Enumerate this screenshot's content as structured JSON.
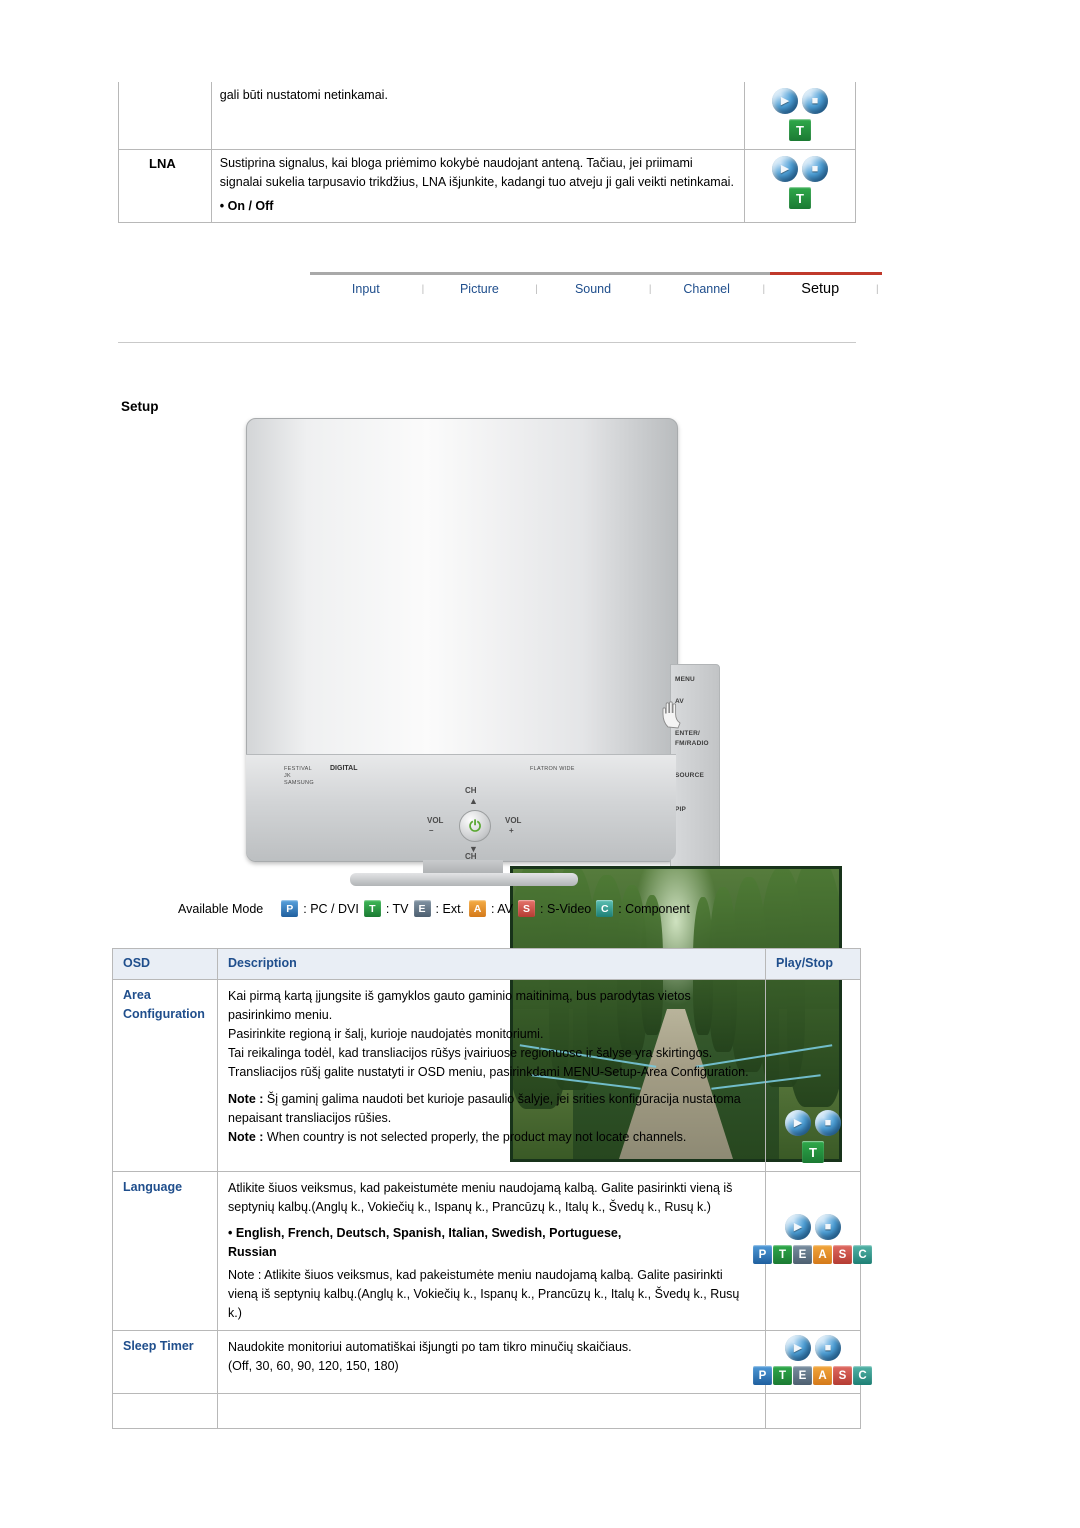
{
  "top_section": {
    "intro_line": "gali būti nustatomi netinkamai.",
    "rows": [
      {
        "label": "LNA",
        "text": "Sustiprina signalus, kai bloga priėmimo kokybė naudojant anteną. Tačiau, jei priimami signalai sukelia tarpusavio trikdžius, LNA išjunkite, kadangi tuo atveju ji gali veikti netinkamai.",
        "bullet": "• On / Off"
      }
    ]
  },
  "nav": {
    "items": [
      {
        "label": "Input",
        "active": false
      },
      {
        "label": "Picture",
        "active": false
      },
      {
        "label": "Sound",
        "active": false
      },
      {
        "label": "Channel",
        "active": false
      },
      {
        "label": "Setup",
        "active": true
      }
    ],
    "separator": "|"
  },
  "section": {
    "heading": "Setup"
  },
  "tv": {
    "logo_left_line1": "FESTIVAL",
    "logo_left_line2": "JK",
    "logo_left_line3": "SAMSUNG",
    "logo_dd": "DIGITAL",
    "logo_right": "FLATRON WIDE",
    "controls": {
      "ch_up": "CH",
      "ch_down": "CH",
      "vol_left": "VOL",
      "vol_right": "VOL",
      "vol_minus": "–",
      "vol_plus": "+",
      "power_icon": "power-icon"
    },
    "side_buttons": [
      "MENU",
      "AV",
      "ENTER/",
      "FM/RADIO",
      "SOURCE",
      "PIP"
    ]
  },
  "available_mode": {
    "label": "Available Mode",
    "items": [
      {
        "chip": "P",
        "text": ": PC / DVI",
        "color": "#2f78bd"
      },
      {
        "chip": "T",
        "text": ": TV",
        "color": "#2f9a44"
      },
      {
        "chip": "E",
        "text": ": Ext.",
        "color": "#6b7d8c"
      },
      {
        "chip": "A",
        "text": ": AV",
        "color": "#ee9b2a"
      },
      {
        "chip": "S",
        "text": ": S-Video",
        "color": "#d7544b"
      },
      {
        "chip": "C",
        "text": ": Component",
        "color": "#3aa79b"
      }
    ]
  },
  "osd_table": {
    "headers": [
      "OSD",
      "Description",
      "Play/Stop"
    ],
    "rows": [
      {
        "name_line1": "Area",
        "name_line2": "Configuration",
        "paragraphs": [
          "Kai pirmą kartą įjungsite iš gamyklos gauto gaminio maitinimą, bus parodytas vietos pasirinkimo meniu.",
          "Pasirinkite regioną ir šalį, kurioje naudojatės monitoriumi.",
          "Tai reikalinga todėl, kad transliacijos rūšys įvairiuose regionuose ir šalyse yra skirtingos.",
          "Transliacijos rūšį galite nustatyti ir OSD meniu, pasirinkdami MENU-Setup-Area Configuration."
        ],
        "notes": [
          {
            "bold": "Note :",
            "text": " Šį gaminį galima naudoti bet kurioje pasaulio šalyje, jei srities konfigūracija nustatoma nepaisant transliacijos rūšies."
          },
          {
            "bold": "Note :",
            "text": " When country is not selected properly, the product may not locate channels."
          }
        ],
        "play": {
          "balls": true,
          "tbadge": "T",
          "strip": []
        }
      },
      {
        "name_line1": "Language",
        "name_line2": "",
        "paragraphs": [
          "Atlikite šiuos veiksmus, kad pakeistumėte meniu naudojamą kalbą. Galite pasirinkti vieną iš septynių kalbų.(Anglų k., Vokiečių k., Ispanų k., Prancūzų k., Italų k., Švedų k., Rusų k.)"
        ],
        "bullet_bold_line1": "• English, French, Deutsch, Spanish, Italian, Swedish, Portuguese,",
        "bullet_bold_line2": "Russian",
        "notes": [
          {
            "bold": "",
            "text": "Note : Atlikite šiuos veiksmus, kad pakeistumėte meniu naudojamą kalbą. Galite pasirinkti vieną iš septynių kalbų.(Anglų k., Vokiečių k., Ispanų k., Prancūzų k., Italų k., Švedų k., Rusų k.)"
          }
        ],
        "play": {
          "balls": true,
          "tbadge": "",
          "strip": [
            "P",
            "T",
            "E",
            "A",
            "S",
            "C"
          ]
        }
      },
      {
        "name_line1": "Sleep Timer",
        "name_line2": "",
        "paragraphs": [
          "Naudokite monitoriui automatiškai išjungti po tam tikro minučių skaičiaus.",
          "(Off, 30, 60, 90, 120, 150, 180)"
        ],
        "notes": [],
        "play": {
          "balls": true,
          "tbadge": "",
          "strip": [
            "P",
            "T",
            "E",
            "A",
            "S",
            "C"
          ]
        }
      }
    ]
  }
}
